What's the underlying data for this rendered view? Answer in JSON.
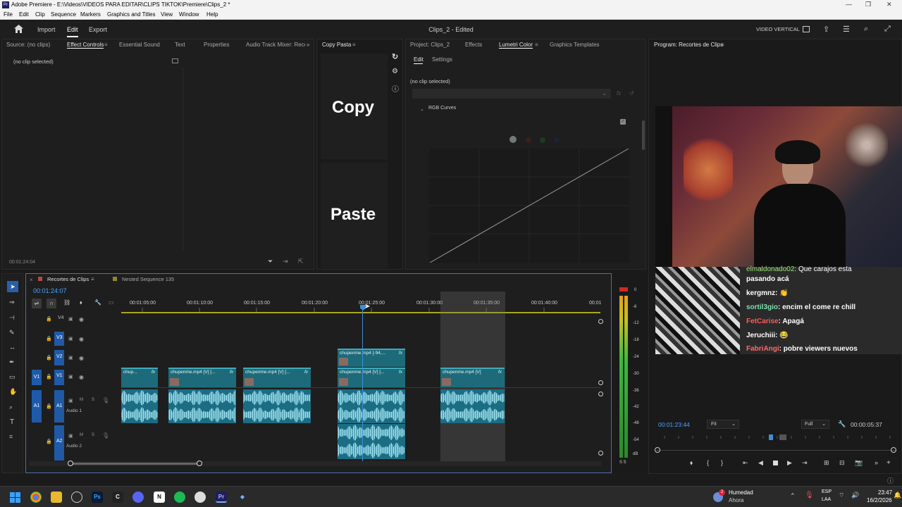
{
  "titlebar": {
    "title": "Adobe Premiere - E:\\Videos\\VIDEOS PARA EDITAR\\CLIPS TIKTOK\\Premiere\\Clips_2 *",
    "app_badge": "Pr"
  },
  "menubar": [
    "File",
    "Edit",
    "Clip",
    "Sequence",
    "Markers",
    "Graphics and Titles",
    "View",
    "Window",
    "Help"
  ],
  "header": {
    "nav": [
      "Import",
      "Edit",
      "Export"
    ],
    "active_nav": "Edit",
    "project_title": "Clips_2 - Edited",
    "workspace": "VIDEO VERTICAL"
  },
  "left_panel": {
    "tabs": [
      "Source: (no clips)",
      "Effect Controls",
      "Essential Sound",
      "Text",
      "Properties",
      "Audio Track Mixer: Recort"
    ],
    "active_tab": "Effect Controls",
    "no_clip": "(no clip selected)",
    "timecode": "00:01:24:04"
  },
  "copy_pasta": {
    "tab": "Copy Pasta",
    "copy_label": "Copy",
    "paste_label": "Paste"
  },
  "lumetri": {
    "tabs": [
      "Project: Clips_2",
      "Effects",
      "Lumetri Color",
      "Graphics Templates"
    ],
    "active_tab": "Lumetri Color",
    "subtabs": [
      "Edit",
      "Settings"
    ],
    "no_clip": "(no clip selected)",
    "section": "RGB Curves"
  },
  "program": {
    "tab": "Program: Recortes de Clips",
    "timecode_left": "00:01:23:44",
    "fit": "Fit",
    "resolution": "Full",
    "timecode_right": "00:00:05:37",
    "chat": [
      {
        "user": "elmaldonado02",
        "msg": ": Que carajos esta",
        "color": "#9be37a"
      },
      {
        "user": "",
        "msg": "pasando acá",
        "color": "#ffffff"
      },
      {
        "user": "kergmnz",
        "msg": ": 👏",
        "color": "#ffffff"
      },
      {
        "user": "sortil3gio",
        "msg": ": encim el come re chill",
        "color": "#7ee0b0"
      },
      {
        "user": "FetCarise",
        "msg": ": Apagá",
        "color": "#ff5a5a"
      },
      {
        "user": "Jeruchiii",
        "msg": ": 😂",
        "color": "#ffffff"
      },
      {
        "user": "FabriAngi",
        "msg": ": pobre viewers nuevos",
        "color": "#ff6a6a"
      }
    ]
  },
  "timeline": {
    "tabs": [
      "Recortes de Clips",
      "Nested Sequence 135"
    ],
    "timecode": "00:01:24:07",
    "ruler": [
      "00:01:05:00",
      "00:01:10:00",
      "00:01:15:00",
      "00:01:20:00",
      "00:01:25:00",
      "00:01:30:00",
      "00:01:35:00",
      "00:01:40:00",
      "00:01"
    ],
    "tracks": [
      "V4",
      "V3",
      "V2",
      "V1",
      "A1",
      "A2"
    ],
    "audio_names": [
      "Audio 1",
      "Audio 2"
    ],
    "clips_v1": [
      "chup...",
      "chupenme.mp4 [V] [...",
      "chupenme.mp4 [V] [...",
      "chupenme.mp4 [V] [...",
      "chupenme.mp4 [V]"
    ],
    "clip_v2": "chupenme.mp4 [-94,...",
    "fx": "fx",
    "meter_scale": [
      "0",
      "-6",
      "-12",
      "-18",
      "-24",
      "-30",
      "-36",
      "-42",
      "-48",
      "-54",
      "dB"
    ],
    "meter_foot": "S S"
  },
  "taskbar": {
    "weather_title": "Humedad",
    "weather_sub": "Ahora",
    "lang": "ESP",
    "lang_sub": "LAA",
    "time": "23:47",
    "date": "16/2/2026",
    "badge": "2"
  }
}
